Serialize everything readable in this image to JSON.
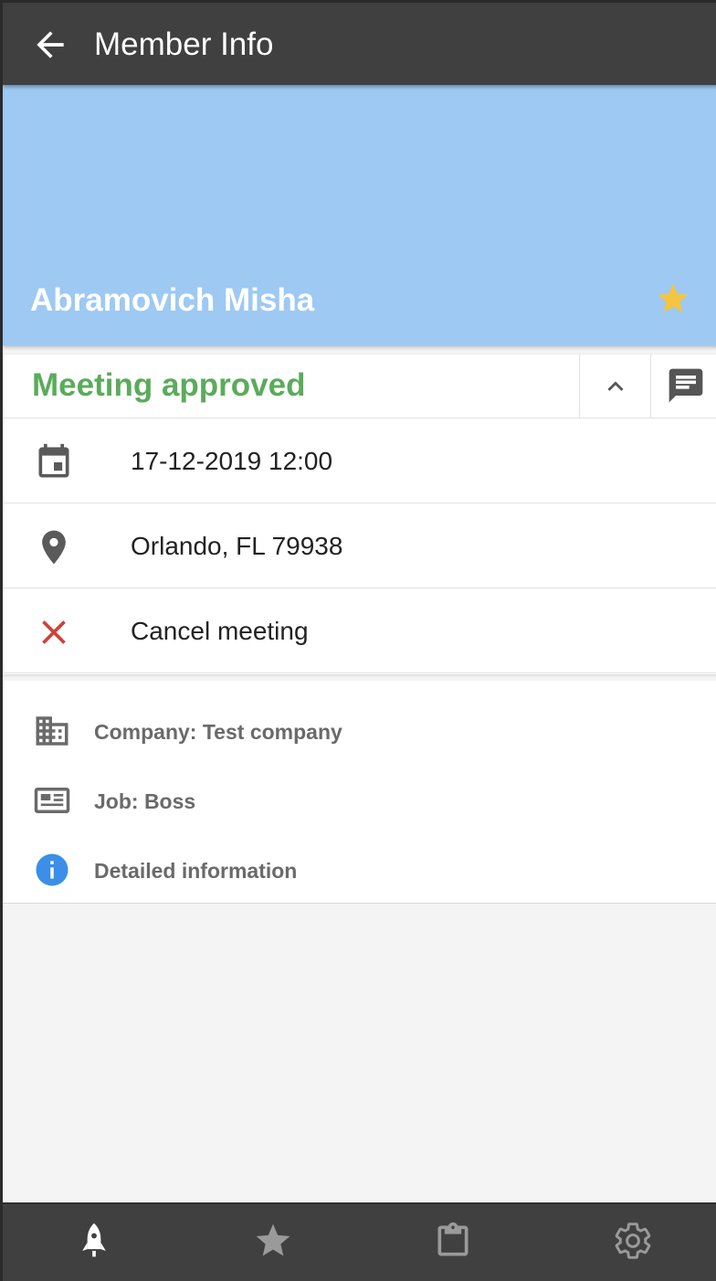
{
  "appbar": {
    "title": "Member Info",
    "back_icon": "arrow-left-icon"
  },
  "header": {
    "background": "#9dc9f3",
    "member_name": "Abramovich Misha",
    "favorite_icon": "star-icon",
    "favorite_color": "#f4c542"
  },
  "meeting": {
    "status": "Meeting approved",
    "status_color": "#5bab5b",
    "collapse_icon": "chevron-up-icon",
    "chat_icon": "chat-icon",
    "date_time": "17-12-2019 12:00",
    "location": "Orlando, FL 79938",
    "cancel_label": "Cancel meeting",
    "cancel_color": "#d0403a"
  },
  "details": {
    "company": "Company: Test company",
    "job": "Job: Boss",
    "more_info": "Detailed information",
    "info_color": "#3b8fe8"
  },
  "bottom_nav": {
    "items": [
      {
        "icon": "rocket-icon",
        "active": true
      },
      {
        "icon": "star-icon",
        "active": false
      },
      {
        "icon": "clipboard-icon",
        "active": false
      },
      {
        "icon": "gear-icon",
        "active": false
      }
    ]
  }
}
